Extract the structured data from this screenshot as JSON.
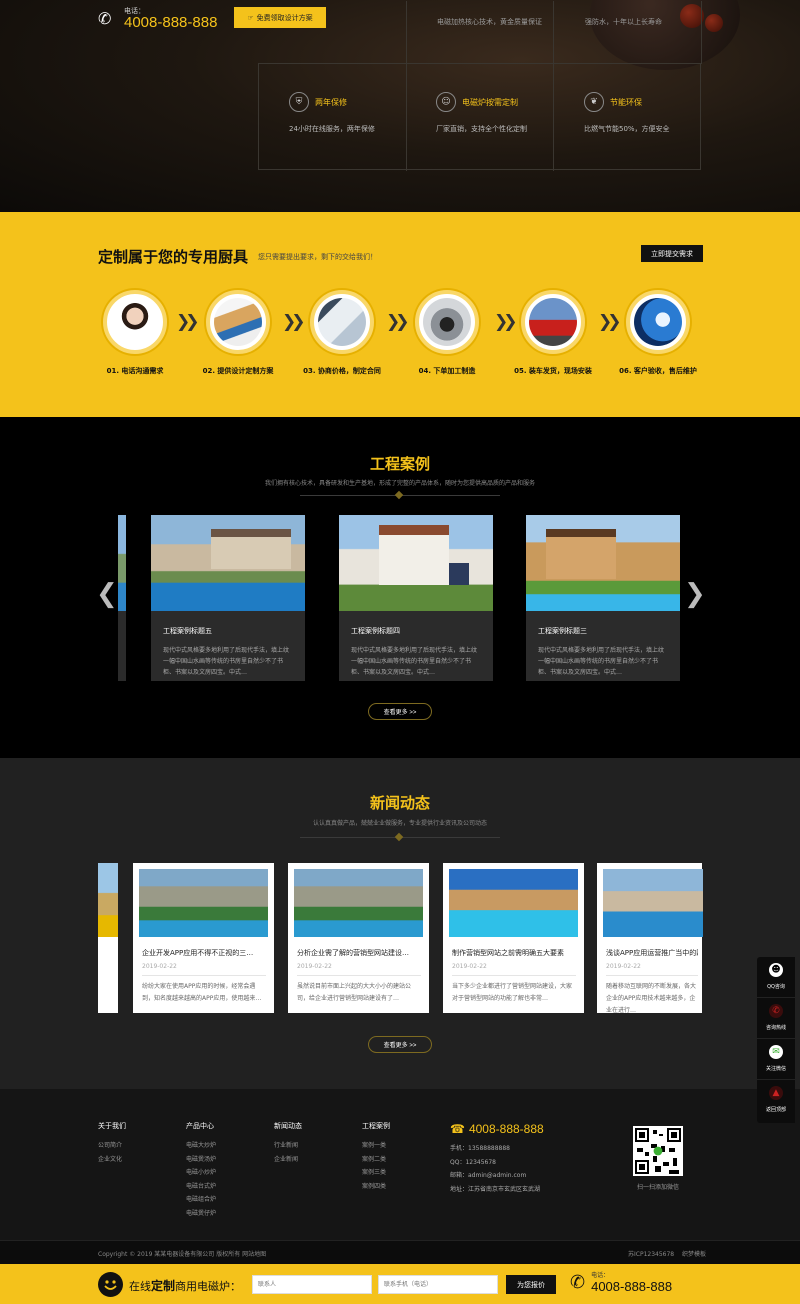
{
  "header": {
    "phone_label": "电话：",
    "phone_number": "4008-888-888",
    "free_design_button": "免费领取设计方案",
    "top_features": [
      "电磁加热核心技术，黄金质量保证",
      "强防水，十年以上长寿命"
    ]
  },
  "features": [
    {
      "title": "两年保修",
      "desc": "24小时在线服务，两年保修",
      "icon": "shield-icon"
    },
    {
      "title": "电磁炉按需定制",
      "desc": "厂家直销，支持全个性化定制",
      "icon": "user-icon"
    },
    {
      "title": "节能环保",
      "desc": "比燃气节能50%，方便安全",
      "icon": "leaf-icon"
    }
  ],
  "process": {
    "heading": "定制属于您的专用厨具",
    "subheading": "您只需要提出要求，剩下的交给我们！",
    "submit_button": "立即提交需求",
    "steps": [
      {
        "label": "01. 电话沟通需求",
        "pic": "customer-service"
      },
      {
        "label": "02. 提供设计定制方案",
        "pic": "design-docs"
      },
      {
        "label": "03. 协商价格，制定合同",
        "pic": "handshake"
      },
      {
        "label": "04. 下单加工制造",
        "pic": "stove-burner"
      },
      {
        "label": "05. 装车发货，现场安装",
        "pic": "truck"
      },
      {
        "label": "06. 客户验收，售后维护",
        "pic": "tech-hand"
      }
    ]
  },
  "cases": {
    "title": "工程案例",
    "subtitle": "我们拥有核心技术，具备研发和生产基地，形成了完整的产品体系，随时为您提供高品质的产品和服务",
    "items": [
      {
        "title": "工程案例标题五",
        "desc": "现代中式风格要多地利用了后现代手法，填上纹一幅中国山水画等传统的书房里自然少不了书柜、书案以及文房四宝。中式…"
      },
      {
        "title": "工程案例标题四",
        "desc": "现代中式风格要多地利用了后现代手法，填上纹一幅中国山水画等传统的书房里自然少不了书柜、书案以及文房四宝。中式…"
      },
      {
        "title": "工程案例标题三",
        "desc": "现代中式风格要多地利用了后现代手法，填上纹一幅中国山水画等传统的书房里自然少不了书柜、书案以及文房四宝。中式…"
      }
    ],
    "more_button": "查看更多 >>"
  },
  "news": {
    "title": "新闻动态",
    "subtitle": "认认真真做产品，兢兢业业做服务，专业提供行业资讯及公司动态",
    "items": [
      {
        "title": "企业开发APP应用不得不正视的三…",
        "date": "2019-02-22",
        "desc": "纷纷大家在使用APP应用的时候，经常会遇到，知名度越来越高的APP应用，使用越来…"
      },
      {
        "title": "分析企业需了解的营销型网站建设…",
        "date": "2019-02-22",
        "desc": "虽然说目前市面上兴起的大大小小的建站公司，给企业进行营销型网站建设有了…"
      },
      {
        "title": "制作营销型网站之前需明确五大要素",
        "date": "2019-02-22",
        "desc": "当下多少企业都进行了营销型网站建设，大家对于营销型网站的功能了解也非常…"
      },
      {
        "title": "浅谈APP应用运营推广当中的四…",
        "date": "2019-02-22",
        "desc": "随着移动互联网的不断发展，各大企业的APP应用技术越来越多，企业在进行…"
      }
    ],
    "more_button": "查看更多 >>"
  },
  "footer": {
    "columns": [
      {
        "heading": "关于我们",
        "items": [
          "公司简介",
          "企业文化"
        ]
      },
      {
        "heading": "产品中心",
        "items": [
          "电磁大炒炉",
          "电磁煲汤炉",
          "电磁小炒炉",
          "电磁台式炉",
          "电磁组合炉",
          "电磁煲仔炉"
        ]
      },
      {
        "heading": "新闻动态",
        "items": [
          "行业新闻",
          "企业新闻"
        ]
      },
      {
        "heading": "工程案例",
        "items": [
          "案例一类",
          "案例二类",
          "案例三类",
          "案例四类"
        ]
      }
    ],
    "contact": {
      "phone": "4008-888-888",
      "mobile": "手机：13588888888",
      "qq": "QQ：12345678",
      "email": "邮箱：admin@admin.com",
      "address": "地址：江苏省南京市玄武区玄武湖"
    },
    "qr_caption": "扫一扫添加微信",
    "copyright": "Copyright © 2019 某某电器设备有限公司 版权所有   网站地图",
    "icp": "苏ICP12345678   织梦模板"
  },
  "bottom_bar": {
    "lead_text": "在线",
    "bold_text": "定制",
    "tail_text": "商用电磁炉：",
    "name_placeholder": "联系人",
    "phone_placeholder": "联系手机（电话）",
    "quote_button": "为您报价",
    "phone_label": "电话：",
    "phone_number": "4008-888-888"
  },
  "sidebar": {
    "items": [
      {
        "label": "QQ咨询",
        "icon": "qq-icon"
      },
      {
        "label": "咨询热线",
        "icon": "phone-icon"
      },
      {
        "label": "关注微信",
        "icon": "wechat-icon"
      },
      {
        "label": "返回顶部",
        "icon": "arrow-up-icon"
      }
    ]
  },
  "colors": {
    "accent": "#f4c21b",
    "dark": "#000000",
    "news_bg": "#212121"
  }
}
